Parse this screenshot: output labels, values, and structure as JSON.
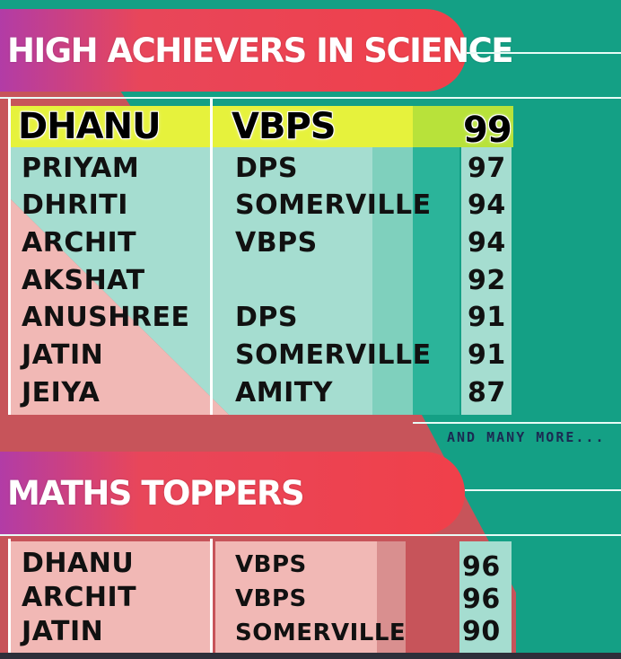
{
  "colors": {
    "background_teal": "#14a085",
    "banner_pink": "#f0404a",
    "banner_purple": "#b23ca6",
    "highlight_yellow": "#e6f23c",
    "panel_pink": "#f1b8b5",
    "panel_mint": "#a5ddd0"
  },
  "science": {
    "title": "HIGH ACHIEVERS IN SCIENCE",
    "top": {
      "name": "DHANU",
      "school": "VBPS",
      "score": "99"
    },
    "rows": [
      {
        "name": "PRIYAM",
        "school": "DPS",
        "score": "97"
      },
      {
        "name": "DHRITI",
        "school": "SOMERVILLE",
        "score": "94"
      },
      {
        "name": "ARCHIT",
        "school": "VBPS",
        "score": "94"
      },
      {
        "name": "AKSHAT",
        "school": "",
        "score": "92"
      },
      {
        "name": "ANUSHREE",
        "school": "DPS",
        "score": "91"
      },
      {
        "name": "JATIN",
        "school": "SOMERVILLE",
        "score": "91"
      },
      {
        "name": "JEIYA",
        "school": "AMITY",
        "score": "87"
      }
    ],
    "more": "AND MANY MORE..."
  },
  "maths": {
    "title": "MATHS TOPPERS",
    "rows": [
      {
        "name": "DHANU",
        "school": "VBPS",
        "score": "96"
      },
      {
        "name": "ARCHIT",
        "school": "VBPS",
        "score": "96"
      },
      {
        "name": "JATIN",
        "school": "SOMERVILLE",
        "score": "90"
      }
    ]
  }
}
